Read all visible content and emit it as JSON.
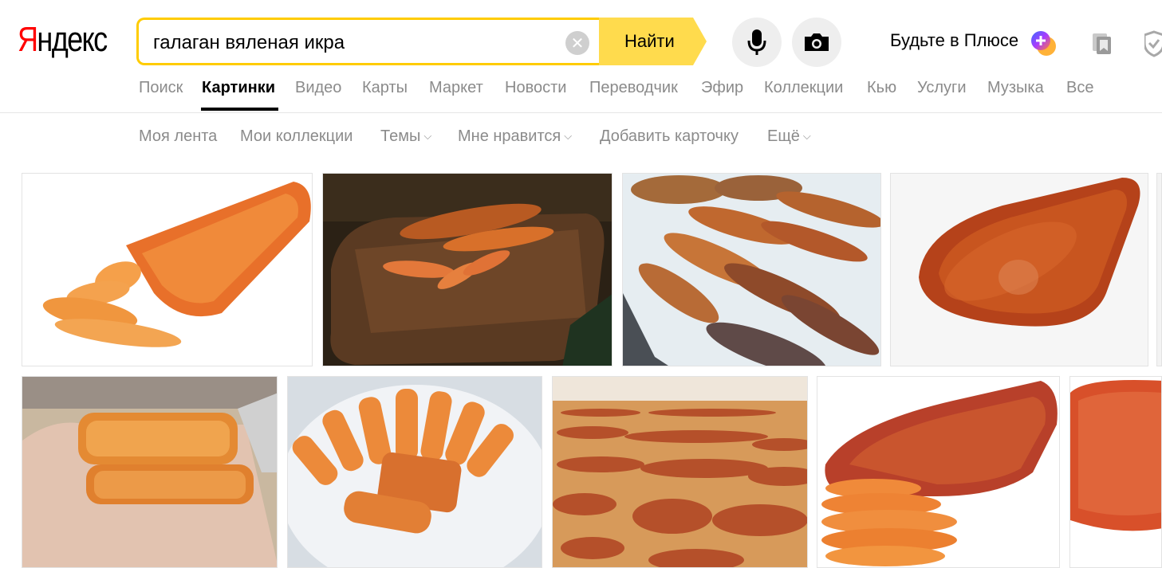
{
  "logo": {
    "first": "Я",
    "rest": "ндекс"
  },
  "search": {
    "query": "галаган вяленая икра",
    "find_label": "Найти"
  },
  "plus": {
    "label": "Будьте в Плюсе",
    "badge": "+"
  },
  "nav": {
    "items": [
      "Поиск",
      "Картинки",
      "Видео",
      "Карты",
      "Маркет",
      "Новости",
      "Переводчик",
      "Эфир",
      "Коллекции",
      "Кью",
      "Услуги",
      "Музыка",
      "Все"
    ],
    "active_index": 1
  },
  "subnav": {
    "items": [
      "Моя лента",
      "Мои коллекции",
      "Темы",
      "Мне нравится",
      "Добавить карточку",
      "Ещё"
    ],
    "caret": "⌵"
  },
  "icons": {
    "mic": "microphone-icon",
    "camera": "camera-icon",
    "clear": "clear-icon",
    "collections": "collections-icon",
    "shield": "shield-icon"
  },
  "colors": {
    "accent": "#ffdb4d",
    "search_border": "#ffcc00",
    "logo_red": "#ff0000",
    "nav_inactive": "#8b8b8b",
    "plus_gradient": [
      "#3a6bff",
      "#a83bff",
      "#ff7a3b"
    ]
  },
  "results": {
    "count": 10,
    "subjects": [
      "dried roe sliced",
      "roe on wooden board",
      "dried roe on table",
      "glossy roe closeup",
      "roe in hand",
      "roe slices on plate",
      "roe drying racks",
      "roe with slices",
      "roe closeup cropped"
    ]
  }
}
